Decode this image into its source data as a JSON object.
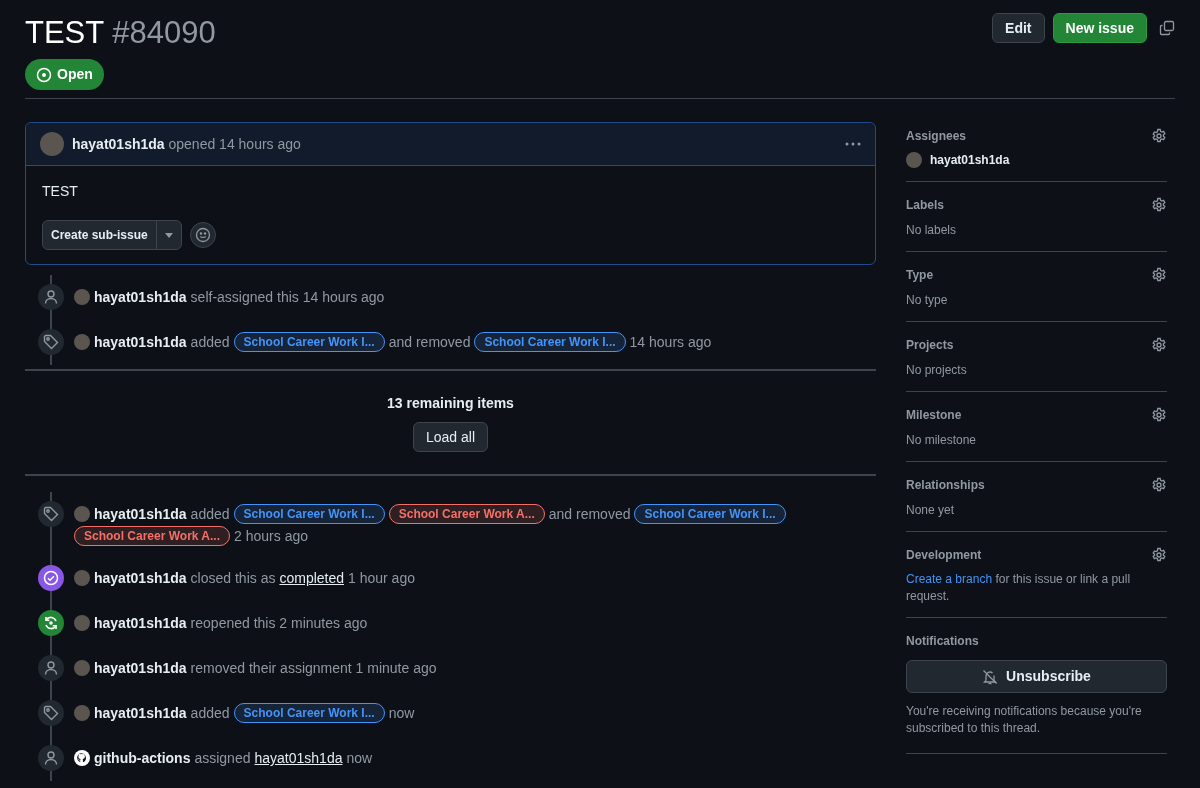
{
  "header": {
    "title": "TEST",
    "number": "#84090",
    "state": "Open",
    "buttons": [
      {
        "label": "Edit",
        "kind": "secondary"
      },
      {
        "label": "New issue",
        "kind": "primary"
      }
    ]
  },
  "comment": {
    "author": "hayat01sh1da",
    "meta": "opened 14 hours ago",
    "body": "TEST",
    "split_button": "Create sub-issue"
  },
  "timeline_top": [
    {
      "kind": "assigned",
      "actor": "hayat01sh1da",
      "parts": [
        {
          "kind": "text",
          "text": "self-assigned this 14 hours ago"
        }
      ]
    },
    {
      "kind": "labeled",
      "actor": "hayat01sh1da",
      "parts": [
        {
          "kind": "text",
          "text": "added"
        },
        {
          "kind": "label",
          "text": "School Career Work I...",
          "color": "#4493f8"
        },
        {
          "kind": "text",
          "text": "and removed"
        },
        {
          "kind": "label",
          "text": "School Career Work I...",
          "color": "#4493f8"
        },
        {
          "kind": "text",
          "text": "14 hours ago"
        }
      ]
    }
  ],
  "hidden_items": {
    "text": "13 remaining items",
    "button": "Load all"
  },
  "timeline_bottom": [
    {
      "kind": "labeled",
      "actor": "hayat01sh1da",
      "parts": [
        {
          "kind": "text",
          "text": "added"
        },
        {
          "kind": "label",
          "text": "School Career Work I...",
          "color": "#4493f8"
        },
        {
          "kind": "label",
          "text": "School Career Work A...",
          "color": "#f47067"
        },
        {
          "kind": "text",
          "text": "and removed"
        },
        {
          "kind": "label",
          "text": "School Career Work I...",
          "color": "#4493f8"
        },
        {
          "kind": "label",
          "text": "School Career Work A...",
          "color": "#f47067"
        },
        {
          "kind": "text",
          "text": "2 hours ago"
        }
      ]
    },
    {
      "kind": "closed",
      "actor": "hayat01sh1da",
      "parts": [
        {
          "kind": "text",
          "text": "closed this as"
        },
        {
          "kind": "link",
          "text": "completed"
        },
        {
          "kind": "text",
          "text": "1 hour ago"
        }
      ]
    },
    {
      "kind": "reopened",
      "actor": "hayat01sh1da",
      "parts": [
        {
          "kind": "text",
          "text": "reopened this 2 minutes ago"
        }
      ]
    },
    {
      "kind": "unassigned",
      "actor": "hayat01sh1da",
      "parts": [
        {
          "kind": "text",
          "text": "removed their assignment 1 minute ago"
        }
      ]
    },
    {
      "kind": "labeled",
      "actor": "hayat01sh1da",
      "parts": [
        {
          "kind": "text",
          "text": "added"
        },
        {
          "kind": "label",
          "text": "School Career Work I...",
          "color": "#4493f8"
        },
        {
          "kind": "text",
          "text": "now"
        }
      ]
    },
    {
      "kind": "bot_assigned",
      "actor": "github-actions",
      "parts": [
        {
          "kind": "text",
          "text": "assigned"
        },
        {
          "kind": "link",
          "text": "hayat01sh1da"
        },
        {
          "kind": "text",
          "text": "now"
        }
      ]
    }
  ],
  "sidebar": [
    {
      "kind": "assignees",
      "title": "Assignees",
      "value": "hayat01sh1da"
    },
    {
      "kind": "empty",
      "title": "Labels",
      "value": "No labels"
    },
    {
      "kind": "empty",
      "title": "Type",
      "value": "No type"
    },
    {
      "kind": "empty",
      "title": "Projects",
      "value": "No projects"
    },
    {
      "kind": "empty",
      "title": "Milestone",
      "value": "No milestone"
    },
    {
      "kind": "empty",
      "title": "Relationships",
      "value": "None yet"
    },
    {
      "kind": "development",
      "title": "Development",
      "link": "Create a branch",
      "text": "for this issue or link a pull request."
    },
    {
      "kind": "notifications",
      "title": "Notifications",
      "button": "Unsubscribe",
      "note": "You're receiving notifications because you're subscribed to this thread."
    }
  ]
}
